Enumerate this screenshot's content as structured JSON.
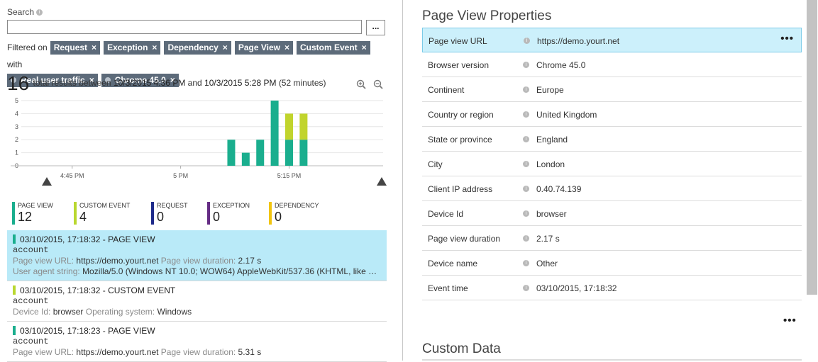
{
  "search": {
    "label": "Search",
    "value": "",
    "more_label": "..."
  },
  "filters": {
    "prefix": "Filtered on",
    "connector": "with",
    "types": [
      "Request",
      "Exception",
      "Dependency",
      "Page View",
      "Custom Event"
    ],
    "properties": [
      "Real user traffic",
      "Chrome 45.0"
    ]
  },
  "results": {
    "count": "16",
    "text": "total results between",
    "start": "10/3/2015 4:36 PM",
    "and": "and",
    "end": "10/3/2015 5:28 PM",
    "duration": "(52 minutes)"
  },
  "chart_data": {
    "type": "bar",
    "stacked": true,
    "y_ticks": [
      0,
      1,
      2,
      3,
      4,
      5
    ],
    "ylim": [
      0,
      5
    ],
    "x_tick_labels": [
      "4:45 PM",
      "5 PM",
      "5:15 PM"
    ],
    "x_ticks_minutes": [
      9,
      24,
      39
    ],
    "xlim_minutes": [
      0,
      52
    ],
    "bars": [
      {
        "minute": 31,
        "page_view": 2,
        "custom_event": 0
      },
      {
        "minute": 33,
        "page_view": 1,
        "custom_event": 0
      },
      {
        "minute": 35,
        "page_view": 2,
        "custom_event": 0
      },
      {
        "minute": 37,
        "page_view": 5,
        "custom_event": 0
      },
      {
        "minute": 39,
        "page_view": 2,
        "custom_event": 2
      },
      {
        "minute": 41,
        "page_view": 2,
        "custom_event": 2
      }
    ],
    "colors": {
      "page_view": "#1aae8e",
      "custom_event": "#c1d42d"
    },
    "grid": true
  },
  "legend": [
    {
      "label": "PAGE VIEW",
      "value": "12",
      "color": "#1aae8e"
    },
    {
      "label": "CUSTOM EVENT",
      "value": "4",
      "color": "#b9d72f"
    },
    {
      "label": "REQUEST",
      "value": "0",
      "color": "#1e2a8a"
    },
    {
      "label": "EXCEPTION",
      "value": "0",
      "color": "#652d85"
    },
    {
      "label": "DEPENDENCY",
      "value": "0",
      "color": "#f1c40f"
    }
  ],
  "events": [
    {
      "title": "03/10/2015, 17:18:32 - PAGE VIEW",
      "name": "account",
      "color": "#1aae8e",
      "lines": [
        [
          [
            "Page view URL:",
            "https://demo.yourt.net"
          ],
          [
            "Page view duration:",
            "2.17 s"
          ]
        ],
        [
          [
            "User agent string:",
            "Mozilla/5.0 (Windows NT 10.0; WOW64) AppleWebKit/537.36 (KHTML, like G..."
          ]
        ]
      ]
    },
    {
      "title": "03/10/2015, 17:18:32 - CUSTOM EVENT",
      "name": "account",
      "color": "#b9d72f",
      "lines": [
        [
          [
            "Device Id:",
            "browser"
          ],
          [
            "Operating system:",
            "Windows"
          ]
        ]
      ]
    },
    {
      "title": "03/10/2015, 17:18:23 - PAGE VIEW",
      "name": "account",
      "color": "#1aae8e",
      "lines": [
        [
          [
            "Page view URL:",
            "https://demo.yourt.net"
          ],
          [
            "Page view duration:",
            "5.31 s"
          ]
        ]
      ]
    }
  ],
  "properties": {
    "title": "Page View Properties",
    "rows": [
      {
        "key": "Page view URL",
        "value": "https://demo.yourt.net"
      },
      {
        "key": "Browser version",
        "value": "Chrome 45.0"
      },
      {
        "key": "Continent",
        "value": "Europe"
      },
      {
        "key": "Country or region",
        "value": "United Kingdom"
      },
      {
        "key": "State or province",
        "value": "England"
      },
      {
        "key": "City",
        "value": "London"
      },
      {
        "key": "Client IP address",
        "value": "0.40.74.139"
      },
      {
        "key": "Device Id",
        "value": "browser"
      },
      {
        "key": "Page view duration",
        "value": "2.17 s"
      },
      {
        "key": "Device name",
        "value": "Other"
      },
      {
        "key": "Event time",
        "value": "03/10/2015, 17:18:32"
      }
    ],
    "more_label": "•••"
  },
  "custom_data": {
    "title": "Custom Data"
  }
}
